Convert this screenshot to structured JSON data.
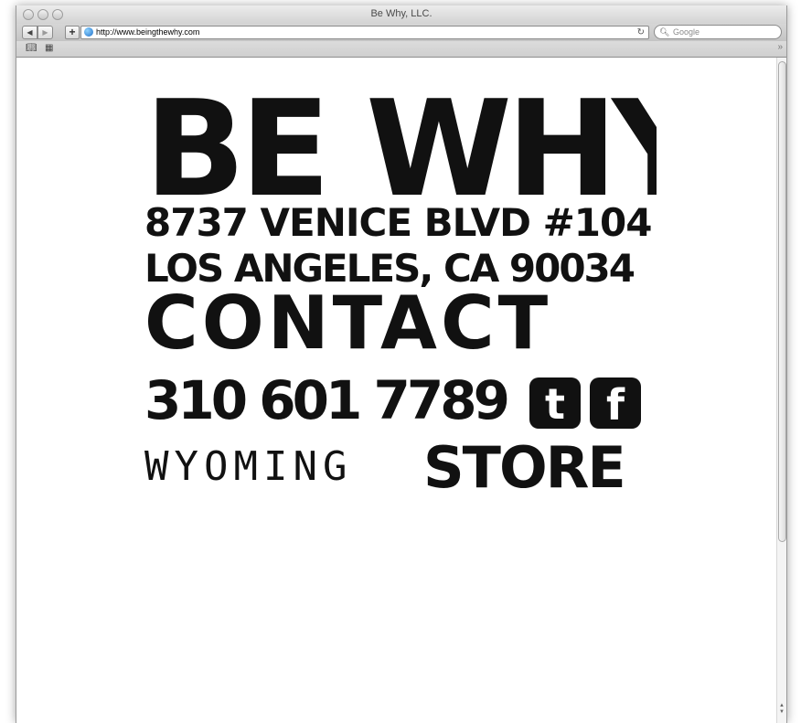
{
  "window": {
    "title": "Be Why, LLC."
  },
  "toolbar": {
    "back_label": "◀",
    "forward_label": "▶",
    "add_label": "+",
    "url": "http://www.beingthewhy.com",
    "search_placeholder": "Google"
  },
  "page": {
    "logo_text": "BE WHY",
    "address_line1": "8737 VENICE BLVD #104",
    "address_line2": "LOS ANGELES, CA 90034",
    "contact_label": "CONTACT",
    "phone": "310 601 7789",
    "twitter_letter": "t",
    "facebook_letter": "f",
    "wyoming_label": "WYOMING",
    "store_label": "STORE"
  },
  "icons": {
    "back": "back-arrow-icon",
    "forward": "forward-arrow-icon",
    "bookmarks": "open-book-icon",
    "topsites": "grid-icon",
    "search": "magnifier-icon",
    "reload": "reload-icon",
    "globe": "globe-icon"
  },
  "colors": {
    "ink": "#111111",
    "chrome": "#d3d3d3",
    "background": "#ffffff"
  }
}
